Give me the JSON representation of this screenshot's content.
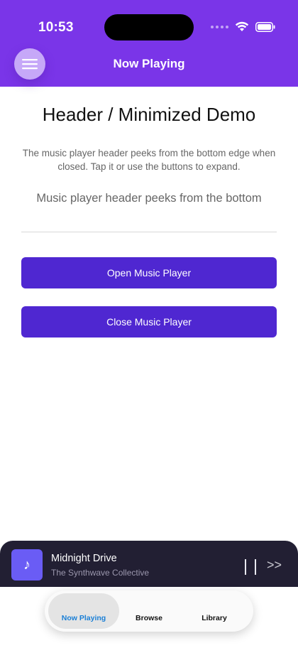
{
  "status_bar": {
    "time": "10:53"
  },
  "nav": {
    "title": "Now Playing",
    "menu_icon": "hamburger-menu-icon"
  },
  "main": {
    "title": "Header / Minimized Demo",
    "description": "The music player header peeks from the bottom edge when closed. Tap it or use the buttons to expand.",
    "status_text": "Music player header peeks from the bottom",
    "open_button_label": "Open Music Player",
    "close_button_label": "Close Music Player"
  },
  "player": {
    "track_title": "Midnight Drive",
    "artist": "The Synthwave Collective",
    "art_icon": "music-note-icon",
    "art_glyph": "♪",
    "pause_icon": "pause-icon",
    "next_glyph": ">>"
  },
  "tabs": [
    {
      "label": "Now Playing",
      "active": true
    },
    {
      "label": "Browse",
      "active": false
    },
    {
      "label": "Library",
      "active": false
    }
  ],
  "colors": {
    "header_purple": "#7a35e8",
    "button_purple": "#4f27d1",
    "player_bg": "#221f33",
    "art_bg": "#6a5cf5",
    "active_tab_text": "#1a7fd6"
  }
}
